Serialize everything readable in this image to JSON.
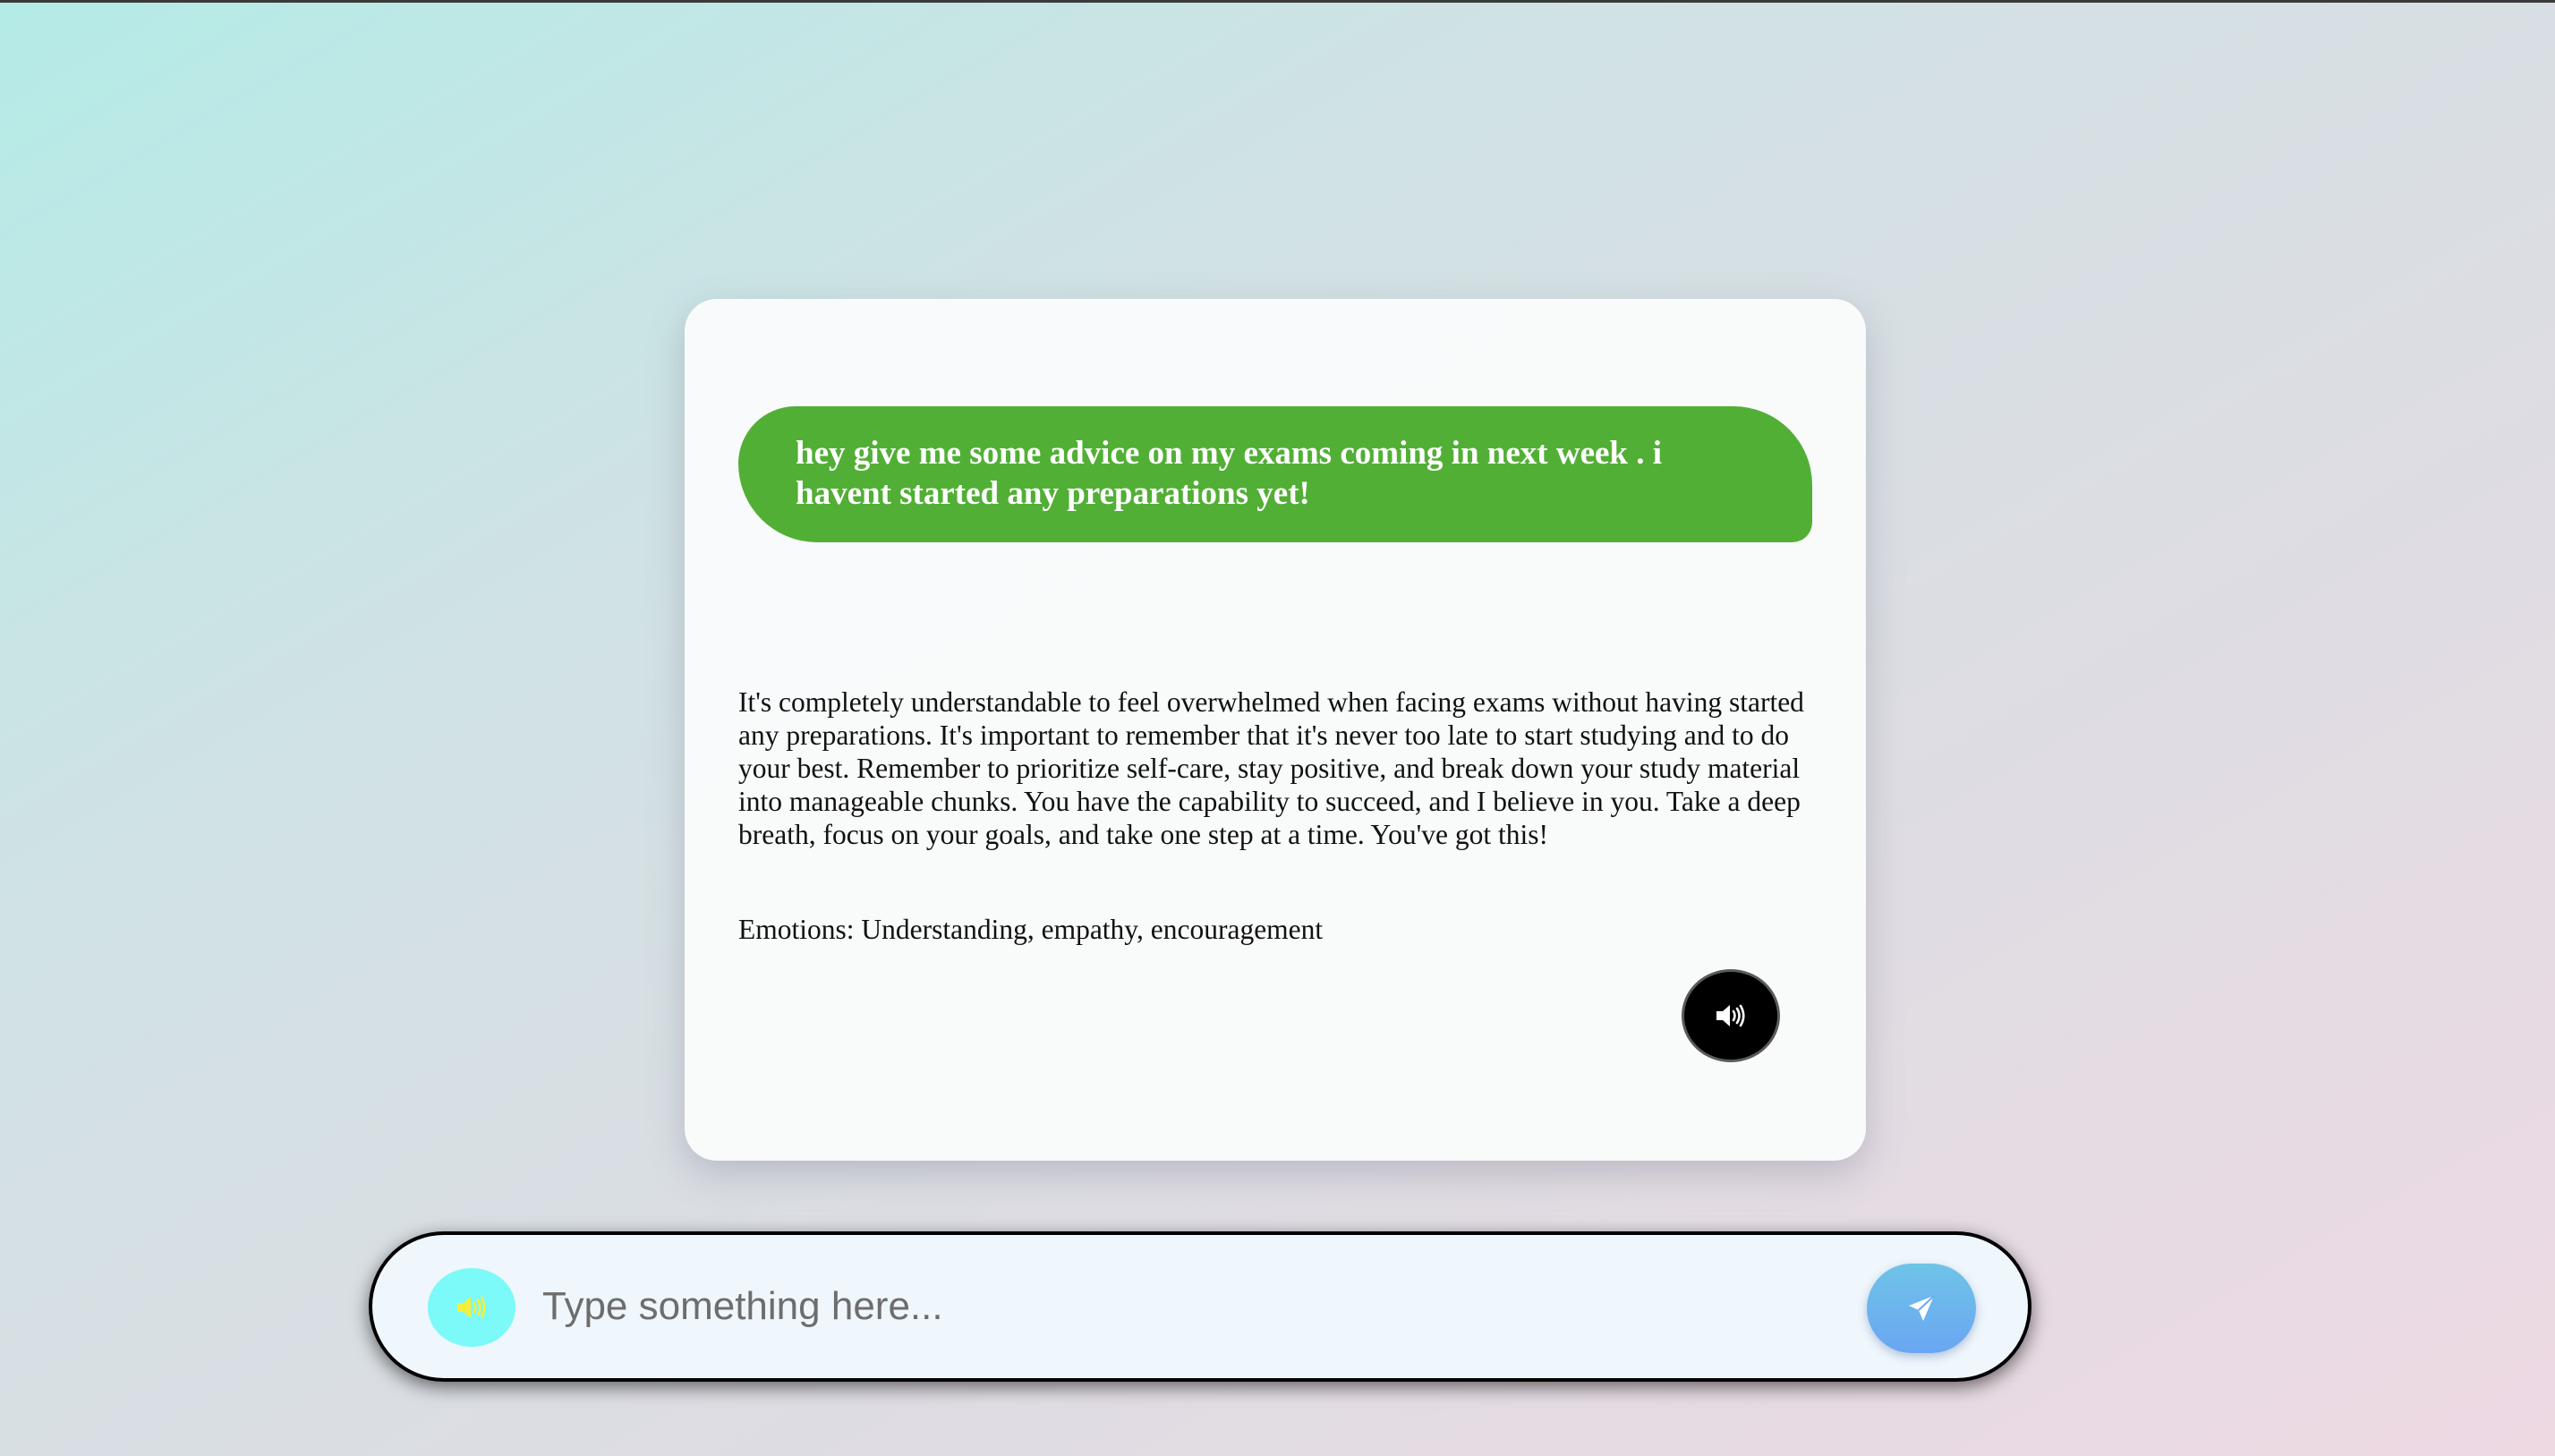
{
  "chat": {
    "user_message": "hey give me some advice on my exams coming in next week . i havent started any preparations yet!",
    "bot_reply": "It's completely understandable to feel overwhelmed when facing exams without having started any preparations. It's important to remember that it's never too late to start studying and to do your best. Remember to prioritize self-care, stay positive, and break down your study material into manageable chunks. You have the capability to succeed, and I believe in you. Take a deep breath, focus on your goals, and take one step at a time. You've got this!",
    "emotions": "Emotions: Understanding, empathy, encouragement",
    "speak_icon": "speaker-icon"
  },
  "input_bar": {
    "mic_icon": "speaker-icon",
    "placeholder": "Type something here...",
    "value": "",
    "send_icon": "send-icon"
  },
  "colors": {
    "user_bubble": "#52af36",
    "speak_button": "#000000",
    "mic_button": "#7cf9f9",
    "mic_icon": "#f3f03c",
    "send_button": "#6aa6f2"
  }
}
